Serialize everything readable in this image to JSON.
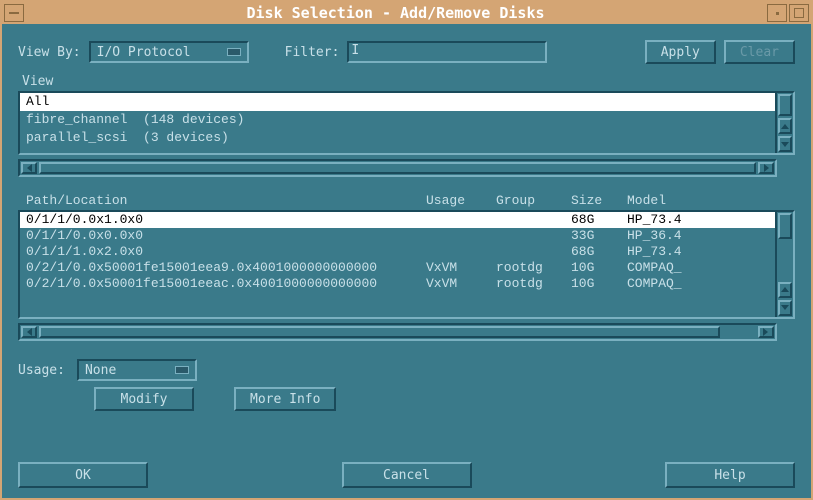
{
  "window": {
    "title": "Disk Selection - Add/Remove Disks"
  },
  "toolbar": {
    "view_by_label": "View By:",
    "view_by_value": "I/O Protocol",
    "filter_label": "Filter:",
    "filter_value": "",
    "apply_label": "Apply",
    "clear_label": "Clear"
  },
  "view_panel": {
    "label": "View",
    "rows": [
      {
        "text": "All",
        "selected": true
      },
      {
        "text": "fibre_channel  (148 devices)",
        "selected": false
      },
      {
        "text": "parallel_scsi  (3 devices)",
        "selected": false
      }
    ]
  },
  "disk_table": {
    "headers": {
      "path": "Path/Location",
      "usage": "Usage",
      "group": "Group",
      "size": "Size",
      "model": "Model"
    },
    "rows": [
      {
        "path": "0/1/1/0.0x1.0x0",
        "usage": "",
        "group": "",
        "size": "68G",
        "model": "HP_73.4",
        "selected": true
      },
      {
        "path": "0/1/1/0.0x0.0x0",
        "usage": "",
        "group": "",
        "size": "33G",
        "model": "HP_36.4",
        "selected": false
      },
      {
        "path": "0/1/1/1.0x2.0x0",
        "usage": "",
        "group": "",
        "size": "68G",
        "model": "HP_73.4",
        "selected": false
      },
      {
        "path": "0/2/1/0.0x50001fe15001eea9.0x4001000000000000",
        "usage": "VxVM",
        "group": "rootdg",
        "size": "10G",
        "model": "COMPAQ_",
        "selected": false
      },
      {
        "path": "0/2/1/0.0x50001fe15001eeac.0x4001000000000000",
        "usage": "VxVM",
        "group": "rootdg",
        "size": "10G",
        "model": "COMPAQ_",
        "selected": false
      }
    ]
  },
  "usage_section": {
    "label": "Usage:",
    "value": "None",
    "modify_label": "Modify",
    "more_info_label": "More Info"
  },
  "footer": {
    "ok_label": "OK",
    "cancel_label": "Cancel",
    "help_label": "Help"
  }
}
